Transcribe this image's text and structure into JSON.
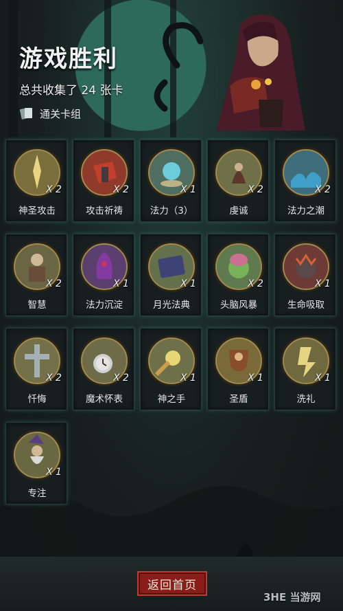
{
  "header": {
    "title": "游戏胜利",
    "subtitle": "总共收集了 24 张卡",
    "deck_label": "通关卡组"
  },
  "cards": [
    {
      "name": "神圣攻击",
      "count": "X 2",
      "icon": "holy-strike-icon",
      "bg": "#7a6e3c"
    },
    {
      "name": "攻击祈祷",
      "count": "X 2",
      "icon": "attack-prayer-icon",
      "bg": "#8f3a2a"
    },
    {
      "name": "法力（3）",
      "count": "X 1",
      "icon": "mana-orb-icon",
      "bg": "#4f6e61"
    },
    {
      "name": "虔诚",
      "count": "X 2",
      "icon": "piety-icon",
      "bg": "#6f7048"
    },
    {
      "name": "法力之潮",
      "count": "X 2",
      "icon": "mana-tide-icon",
      "bg": "#3e6e7c"
    },
    {
      "name": "智慧",
      "count": "X 2",
      "icon": "wisdom-icon",
      "bg": "#6a6644"
    },
    {
      "name": "法力沉淀",
      "count": "X 1",
      "icon": "mana-settle-icon",
      "bg": "#5b3f6e"
    },
    {
      "name": "月光法典",
      "count": "X 1",
      "icon": "moonlight-tome-icon",
      "bg": "#64704c"
    },
    {
      "name": "头脑风暴",
      "count": "X 2",
      "icon": "brainstorm-icon",
      "bg": "#5e7a4e"
    },
    {
      "name": "生命吸取",
      "count": "X 1",
      "icon": "life-drain-icon",
      "bg": "#6e3a36"
    },
    {
      "name": "忏悔",
      "count": "X 2",
      "icon": "penance-cross-icon",
      "bg": "#74704a"
    },
    {
      "name": "魔术怀表",
      "count": "X 2",
      "icon": "magic-pocketwatch-icon",
      "bg": "#6d6b48"
    },
    {
      "name": "神之手",
      "count": "X 1",
      "icon": "hand-of-god-icon",
      "bg": "#6e704a"
    },
    {
      "name": "圣盾",
      "count": "X 1",
      "icon": "holy-shield-icon",
      "bg": "#7a6a3a"
    },
    {
      "name": "洗礼",
      "count": "X 1",
      "icon": "baptism-icon",
      "bg": "#70683e"
    },
    {
      "name": "专注",
      "count": "X 1",
      "icon": "focus-wizard-icon",
      "bg": "#6a6842"
    }
  ],
  "footer": {
    "back_label": "返回首页"
  },
  "watermark": "3HE 当游网",
  "colors": {
    "medal_rim": "#2b2418",
    "medal_inner_rim": "#a08a4e",
    "back_button": "#8a1d19",
    "moon": "#2e6a5c"
  }
}
